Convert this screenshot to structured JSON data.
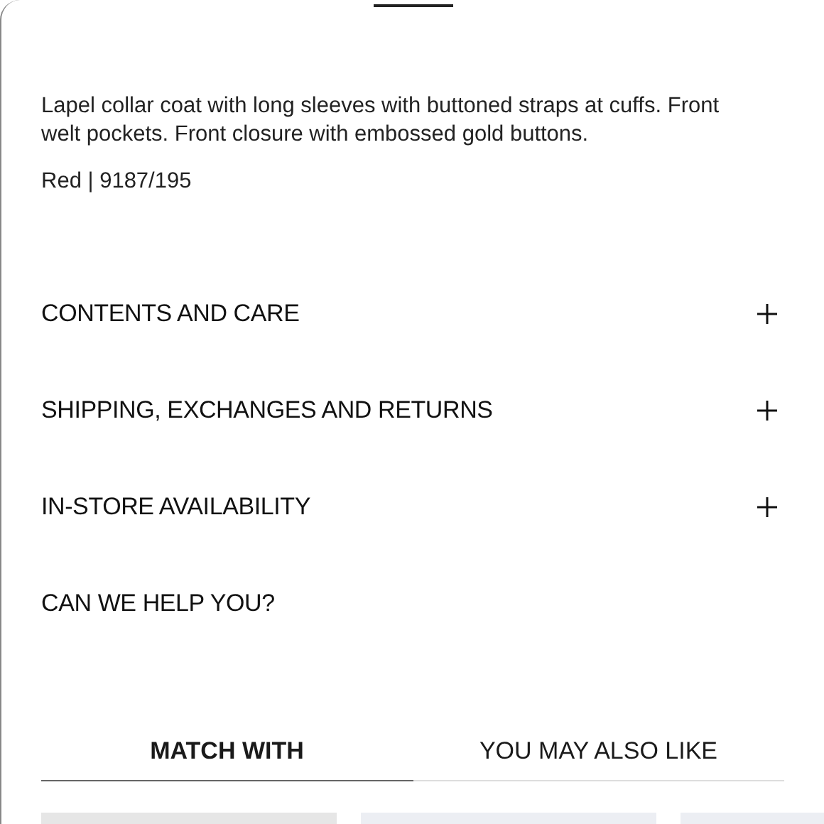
{
  "description": "Lapel collar coat with long sleeves with buttoned straps at cuffs. Front welt pockets. Front closure with embossed gold buttons.",
  "color_reference": "Red | 9187/195",
  "sections": [
    {
      "kind": "accordion",
      "label": "CONTENTS AND CARE",
      "expanded": false
    },
    {
      "kind": "accordion",
      "label": "SHIPPING, EXCHANGES AND RETURNS",
      "expanded": false
    },
    {
      "kind": "accordion",
      "label": "IN-STORE AVAILABILITY",
      "expanded": false
    },
    {
      "kind": "link",
      "label": "CAN WE HELP YOU?"
    }
  ],
  "tabs": [
    {
      "label": "MATCH WITH",
      "selected": true
    },
    {
      "label": "YOU MAY ALSO LIKE",
      "selected": false
    }
  ],
  "products": [
    {
      "kind": "photo"
    },
    {
      "kind": "photo"
    },
    {
      "kind": "photo"
    }
  ]
}
